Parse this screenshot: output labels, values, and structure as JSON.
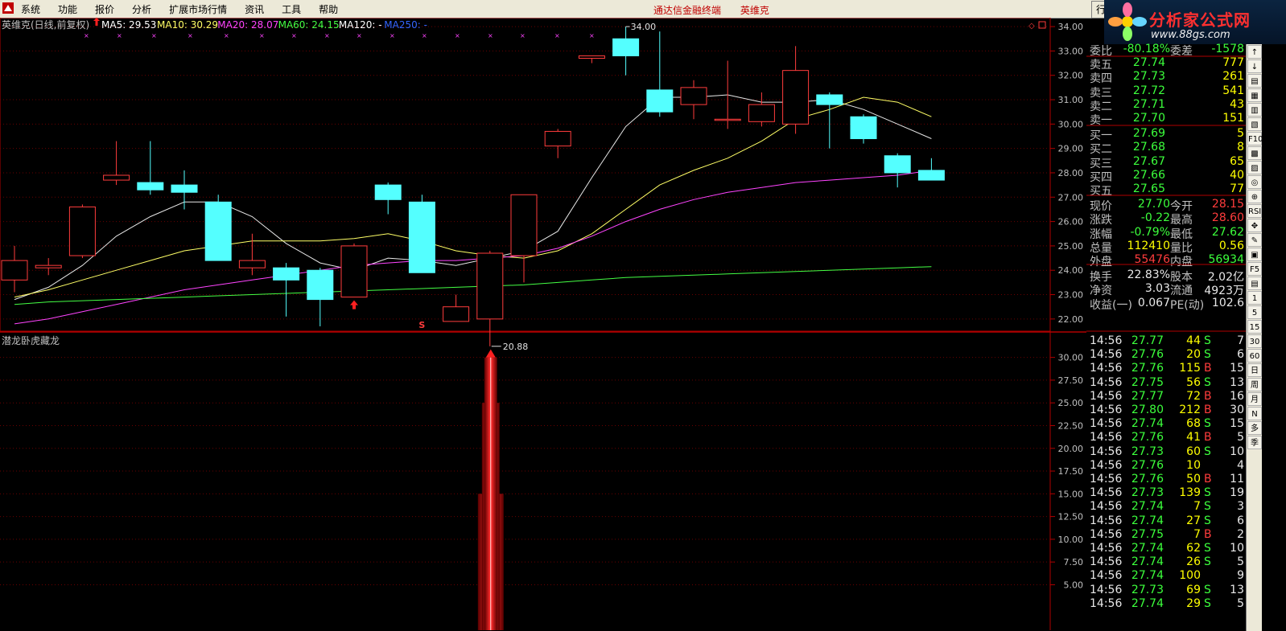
{
  "menubar": {
    "items": [
      "系统",
      "功能",
      "报价",
      "分析",
      "扩展市场行情",
      "资讯",
      "工具",
      "帮助"
    ],
    "center": [
      "通达信金融终端",
      "英维克"
    ],
    "right_tab": "行"
  },
  "brand": {
    "title": "分析家公式网",
    "url": "www.88gs.com"
  },
  "main_panel": {
    "title": "英维克(日线,前复权)",
    "ma_labels": [
      {
        "text": "MA5: 29.53",
        "color": "#ffffff"
      },
      {
        "text": "MA10: 30.29",
        "color": "#ffff66"
      },
      {
        "text": "MA20: 28.07",
        "color": "#ff44ff"
      },
      {
        "text": "MA60: 24.15",
        "color": "#44ff44"
      },
      {
        "text": "MA120: -",
        "color": "#ffffff"
      },
      {
        "text": "MA250: -",
        "color": "#3366ff"
      }
    ],
    "high_label": "34.00",
    "low_label": "20.88",
    "s_marker": "S"
  },
  "sub_panel": {
    "title": "潜龙卧虎藏龙"
  },
  "chart_data": [
    {
      "type": "candlestick",
      "title": "英维克(日线,前复权)",
      "ylim": [
        21.5,
        34.3
      ],
      "y_ticks": [
        22.0,
        23.0,
        24.0,
        25.0,
        26.0,
        27.0,
        28.0,
        29.0,
        30.0,
        31.0,
        32.0,
        33.0,
        34.0
      ],
      "candles": [
        {
          "o": 23.6,
          "h": 25.0,
          "l": 23.1,
          "c": 24.4
        },
        {
          "o": 24.1,
          "h": 24.5,
          "l": 23.8,
          "c": 24.2
        },
        {
          "o": 24.6,
          "h": 26.7,
          "l": 24.5,
          "c": 26.6
        },
        {
          "o": 27.7,
          "h": 29.3,
          "l": 27.5,
          "c": 27.9
        },
        {
          "o": 27.6,
          "h": 29.3,
          "l": 27.1,
          "c": 27.3
        },
        {
          "o": 27.5,
          "h": 28.1,
          "l": 26.5,
          "c": 27.2
        },
        {
          "o": 26.8,
          "h": 27.1,
          "l": 24.4,
          "c": 24.4
        },
        {
          "o": 24.1,
          "h": 25.5,
          "l": 23.8,
          "c": 24.4
        },
        {
          "o": 24.1,
          "h": 24.3,
          "l": 22.1,
          "c": 23.6
        },
        {
          "o": 24.0,
          "h": 24.1,
          "l": 21.7,
          "c": 22.8
        },
        {
          "o": 22.9,
          "h": 25.1,
          "l": 22.9,
          "c": 25.0
        },
        {
          "o": 27.5,
          "h": 27.6,
          "l": 26.3,
          "c": 26.9
        },
        {
          "o": 26.8,
          "h": 27.1,
          "l": 23.9,
          "c": 23.9
        },
        {
          "o": 21.9,
          "h": 23.0,
          "l": 21.9,
          "c": 22.5
        },
        {
          "o": 22.0,
          "h": 24.8,
          "l": 20.88,
          "c": 24.7
        },
        {
          "o": 24.6,
          "h": 27.1,
          "l": 23.5,
          "c": 27.1
        },
        {
          "o": 29.1,
          "h": 29.8,
          "l": 28.6,
          "c": 29.7
        },
        {
          "o": 32.7,
          "h": 32.8,
          "l": 32.5,
          "c": 32.8
        },
        {
          "o": 33.5,
          "h": 34.0,
          "l": 32.0,
          "c": 32.8
        },
        {
          "o": 31.4,
          "h": 33.8,
          "l": 30.3,
          "c": 30.5
        },
        {
          "o": 30.8,
          "h": 31.8,
          "l": 30.2,
          "c": 31.5
        },
        {
          "o": 30.2,
          "h": 32.6,
          "l": 29.8,
          "c": 30.2
        },
        {
          "o": 30.1,
          "h": 31.3,
          "l": 29.9,
          "c": 30.8
        },
        {
          "o": 30.0,
          "h": 33.2,
          "l": 29.6,
          "c": 32.2
        },
        {
          "o": 31.2,
          "h": 31.3,
          "l": 29.0,
          "c": 30.8
        },
        {
          "o": 30.3,
          "h": 30.4,
          "l": 29.2,
          "c": 29.4
        },
        {
          "o": 28.7,
          "h": 28.8,
          "l": 27.4,
          "c": 28.0
        },
        {
          "o": 28.1,
          "h": 28.6,
          "l": 27.7,
          "c": 27.7
        }
      ],
      "series": [
        {
          "name": "MA5",
          "color": "#e8e8e8",
          "values": [
            22.8,
            23.3,
            24.2,
            25.4,
            26.2,
            26.8,
            26.8,
            26.2,
            25.1,
            24.3,
            24.0,
            24.5,
            24.4,
            24.2,
            24.5,
            24.8,
            25.6,
            27.8,
            29.9,
            31.1,
            31.1,
            31.2,
            30.9,
            30.9,
            31.0,
            30.6,
            30.0,
            29.4
          ]
        },
        {
          "name": "MA10",
          "color": "#ffff66",
          "values": [
            22.9,
            23.2,
            23.6,
            24.0,
            24.4,
            24.8,
            25.0,
            25.2,
            25.2,
            25.2,
            25.3,
            25.5,
            25.2,
            24.8,
            24.6,
            24.5,
            24.8,
            25.5,
            26.5,
            27.5,
            28.1,
            28.6,
            29.3,
            30.2,
            30.6,
            31.1,
            30.9,
            30.3
          ]
        },
        {
          "name": "MA20",
          "color": "#ff44ff",
          "values": [
            21.8,
            22.0,
            22.3,
            22.6,
            22.9,
            23.2,
            23.4,
            23.6,
            23.8,
            24.0,
            24.2,
            24.3,
            24.4,
            24.4,
            24.5,
            24.6,
            24.9,
            25.4,
            26.0,
            26.5,
            26.9,
            27.2,
            27.4,
            27.6,
            27.7,
            27.8,
            27.9,
            28.1
          ]
        },
        {
          "name": "MA60",
          "color": "#44ff44",
          "values": [
            22.6,
            22.7,
            22.75,
            22.8,
            22.85,
            22.9,
            22.95,
            23.0,
            23.05,
            23.1,
            23.15,
            23.2,
            23.25,
            23.3,
            23.35,
            23.4,
            23.5,
            23.6,
            23.7,
            23.75,
            23.8,
            23.85,
            23.9,
            23.95,
            24.0,
            24.05,
            24.1,
            24.15
          ]
        }
      ]
    },
    {
      "type": "bar",
      "title": "潜龙卧虎藏龙",
      "ylim": [
        0,
        32
      ],
      "y_ticks": [
        5.0,
        7.5,
        10.0,
        12.5,
        15.0,
        17.5,
        20.0,
        22.5,
        25.0,
        27.5,
        30.0
      ],
      "bar_index": 14,
      "values": [
        15,
        25,
        30
      ]
    }
  ],
  "quote": {
    "header": {
      "label1": "委比",
      "v1": "-80.18%",
      "label2": "委差",
      "v2": "-1578"
    },
    "sell": [
      {
        "label": "卖五",
        "price": "27.74",
        "vol": "777"
      },
      {
        "label": "卖四",
        "price": "27.73",
        "vol": "261"
      },
      {
        "label": "卖三",
        "price": "27.72",
        "vol": "541"
      },
      {
        "label": "卖二",
        "price": "27.71",
        "vol": "43"
      },
      {
        "label": "卖一",
        "price": "27.70",
        "vol": "151"
      }
    ],
    "buy": [
      {
        "label": "买一",
        "price": "27.69",
        "vol": "5"
      },
      {
        "label": "买二",
        "price": "27.68",
        "vol": "8"
      },
      {
        "label": "买三",
        "price": "27.67",
        "vol": "65"
      },
      {
        "label": "买四",
        "price": "27.66",
        "vol": "40"
      },
      {
        "label": "买五",
        "price": "27.65",
        "vol": "77"
      }
    ],
    "stats": [
      {
        "l1": "现价",
        "v1": "27.70",
        "c1": "dn",
        "l2": "今开",
        "v2": "28.15",
        "c2": "up"
      },
      {
        "l1": "涨跌",
        "v1": "-0.22",
        "c1": "dn",
        "l2": "最高",
        "v2": "28.60",
        "c2": "up"
      },
      {
        "l1": "涨幅",
        "v1": "-0.79%",
        "c1": "dn",
        "l2": "最低",
        "v2": "27.62",
        "c2": "dn"
      },
      {
        "l1": "总量",
        "v1": "112410",
        "c1": "yl",
        "l2": "量比",
        "v2": "0.56",
        "c2": "yl"
      },
      {
        "l1": "外盘",
        "v1": "55476",
        "c1": "up",
        "l2": "内盘",
        "v2": "56934",
        "c2": "dn"
      }
    ],
    "fund": [
      {
        "l1": "换手",
        "v1": "22.83%",
        "l2": "股本",
        "v2": "2.02亿"
      },
      {
        "l1": "净资",
        "v1": "3.03",
        "l2": "流通",
        "v2": "4923万"
      },
      {
        "l1": "收益(一)",
        "v1": "0.067",
        "l2": "PE(动)",
        "v2": "102.6"
      }
    ],
    "ticks": [
      {
        "t": "14:56",
        "p": "27.77",
        "v": "44",
        "bs": "S",
        "n": "7"
      },
      {
        "t": "14:56",
        "p": "27.76",
        "v": "20",
        "bs": "S",
        "n": "6"
      },
      {
        "t": "14:56",
        "p": "27.76",
        "v": "115",
        "bs": "B",
        "n": "15"
      },
      {
        "t": "14:56",
        "p": "27.75",
        "v": "56",
        "bs": "S",
        "n": "13"
      },
      {
        "t": "14:56",
        "p": "27.77",
        "v": "72",
        "bs": "B",
        "n": "16"
      },
      {
        "t": "14:56",
        "p": "27.80",
        "v": "212",
        "bs": "B",
        "n": "30"
      },
      {
        "t": "14:56",
        "p": "27.74",
        "v": "68",
        "bs": "S",
        "n": "15"
      },
      {
        "t": "14:56",
        "p": "27.76",
        "v": "41",
        "bs": "B",
        "n": "5"
      },
      {
        "t": "14:56",
        "p": "27.73",
        "v": "60",
        "bs": "S",
        "n": "10"
      },
      {
        "t": "14:56",
        "p": "27.76",
        "v": "10",
        "bs": "",
        "n": "4"
      },
      {
        "t": "14:56",
        "p": "27.76",
        "v": "50",
        "bs": "B",
        "n": "11"
      },
      {
        "t": "14:56",
        "p": "27.73",
        "v": "139",
        "bs": "S",
        "n": "19"
      },
      {
        "t": "14:56",
        "p": "27.74",
        "v": "7",
        "bs": "S",
        "n": "3"
      },
      {
        "t": "14:56",
        "p": "27.74",
        "v": "27",
        "bs": "S",
        "n": "6"
      },
      {
        "t": "14:56",
        "p": "27.75",
        "v": "7",
        "bs": "B",
        "n": "2"
      },
      {
        "t": "14:56",
        "p": "27.74",
        "v": "62",
        "bs": "S",
        "n": "10"
      },
      {
        "t": "14:56",
        "p": "27.74",
        "v": "26",
        "bs": "S",
        "n": "5"
      },
      {
        "t": "14:56",
        "p": "27.74",
        "v": "100",
        "bs": "",
        "n": "9"
      },
      {
        "t": "14:56",
        "p": "27.73",
        "v": "69",
        "bs": "S",
        "n": "13"
      },
      {
        "t": "14:56",
        "p": "27.74",
        "v": "29",
        "bs": "S",
        "n": "5"
      }
    ]
  },
  "sidebar": [
    "↑",
    "↓",
    "▤",
    "▦",
    "▥",
    "▧",
    "F10",
    "▩",
    "▨",
    "◎",
    "⊕",
    "RSI",
    "✥",
    "✎",
    "▣",
    "F5",
    "▤",
    "1",
    "5",
    "15",
    "30",
    "60",
    "日",
    "周",
    "月",
    "N",
    "多",
    "季"
  ],
  "colors": {
    "up": "#ff3c3c",
    "down": "#3cff3c",
    "cyan": "#54ffff",
    "grid": "#8b0000",
    "axis": "#b00000"
  }
}
